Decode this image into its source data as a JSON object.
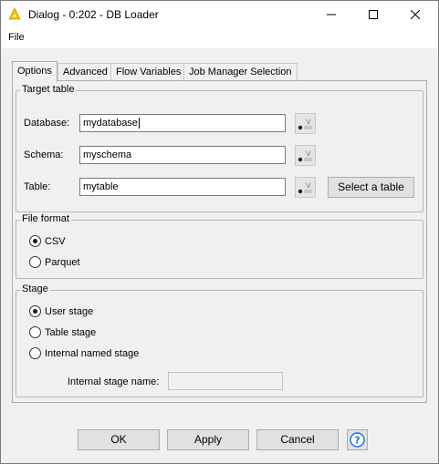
{
  "window": {
    "title": "Dialog - 0:202 - DB Loader"
  },
  "menu": {
    "file": "File"
  },
  "tabs": [
    {
      "label": "Options",
      "active": true
    },
    {
      "label": "Advanced"
    },
    {
      "label": "Flow Variables"
    },
    {
      "label": "Job Manager Selection"
    }
  ],
  "target_table": {
    "title": "Target table",
    "database_label": "Database:",
    "database_value": "mydatabase",
    "schema_label": "Schema:",
    "schema_value": "myschema",
    "table_label": "Table:",
    "table_value": "mytable",
    "select_table_button": "Select a table"
  },
  "file_format": {
    "title": "File format",
    "options": [
      {
        "label": "CSV",
        "checked": true
      },
      {
        "label": "Parquet",
        "checked": false
      }
    ]
  },
  "stage": {
    "title": "Stage",
    "options": [
      {
        "label": "User stage",
        "checked": true
      },
      {
        "label": "Table stage",
        "checked": false
      },
      {
        "label": "Internal named stage",
        "checked": false
      }
    ],
    "internal_stage_name_label": "Internal stage name:",
    "internal_stage_name_value": ""
  },
  "buttons": {
    "ok": "OK",
    "apply": "Apply",
    "cancel": "Cancel",
    "help_icon": "question-circle-icon"
  },
  "colors": {
    "accent": "#0078d7",
    "icon_yellow": "#f5c400",
    "help_blue": "#1e6fd9"
  }
}
